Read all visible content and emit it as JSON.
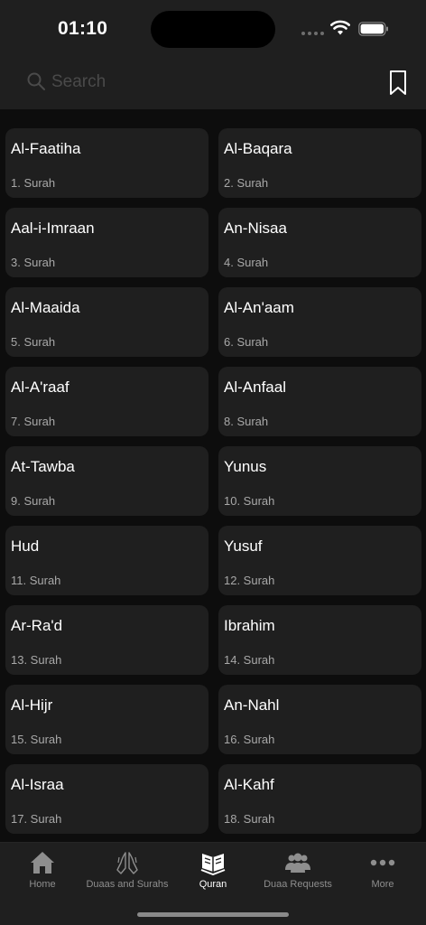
{
  "status_bar": {
    "time": "01:10"
  },
  "search": {
    "placeholder": "Search",
    "value": ""
  },
  "surahs": [
    {
      "name": "Al-Faatiha",
      "sub": "1. Surah"
    },
    {
      "name": "Al-Baqara",
      "sub": "2. Surah"
    },
    {
      "name": "Aal-i-Imraan",
      "sub": "3. Surah"
    },
    {
      "name": "An-Nisaa",
      "sub": "4. Surah"
    },
    {
      "name": "Al-Maaida",
      "sub": "5. Surah"
    },
    {
      "name": "Al-An'aam",
      "sub": "6. Surah"
    },
    {
      "name": "Al-A'raaf",
      "sub": "7. Surah"
    },
    {
      "name": "Al-Anfaal",
      "sub": "8. Surah"
    },
    {
      "name": "At-Tawba",
      "sub": "9. Surah"
    },
    {
      "name": "Yunus",
      "sub": "10. Surah"
    },
    {
      "name": "Hud",
      "sub": "11. Surah"
    },
    {
      "name": "Yusuf",
      "sub": "12. Surah"
    },
    {
      "name": "Ar-Ra'd",
      "sub": "13. Surah"
    },
    {
      "name": "Ibrahim",
      "sub": "14. Surah"
    },
    {
      "name": "Al-Hijr",
      "sub": "15. Surah"
    },
    {
      "name": "An-Nahl",
      "sub": "16. Surah"
    },
    {
      "name": "Al-Israa",
      "sub": "17. Surah"
    },
    {
      "name": "Al-Kahf",
      "sub": "18. Surah"
    }
  ],
  "tabs": [
    {
      "label": "Home",
      "icon": "home-icon",
      "active": false
    },
    {
      "label": "Duaas and Surahs",
      "icon": "praying-hands-icon",
      "active": false
    },
    {
      "label": "Quran",
      "icon": "quran-book-icon",
      "active": true
    },
    {
      "label": "Duaa Requests",
      "icon": "people-icon",
      "active": false
    },
    {
      "label": "More",
      "icon": "more-dots-icon",
      "active": false
    }
  ],
  "colors": {
    "background": "#0d0d0d",
    "surface": "#1f1f1f",
    "text_primary": "#ffffff",
    "text_secondary": "#a8a8a8",
    "tab_inactive": "#8e8e8e"
  }
}
